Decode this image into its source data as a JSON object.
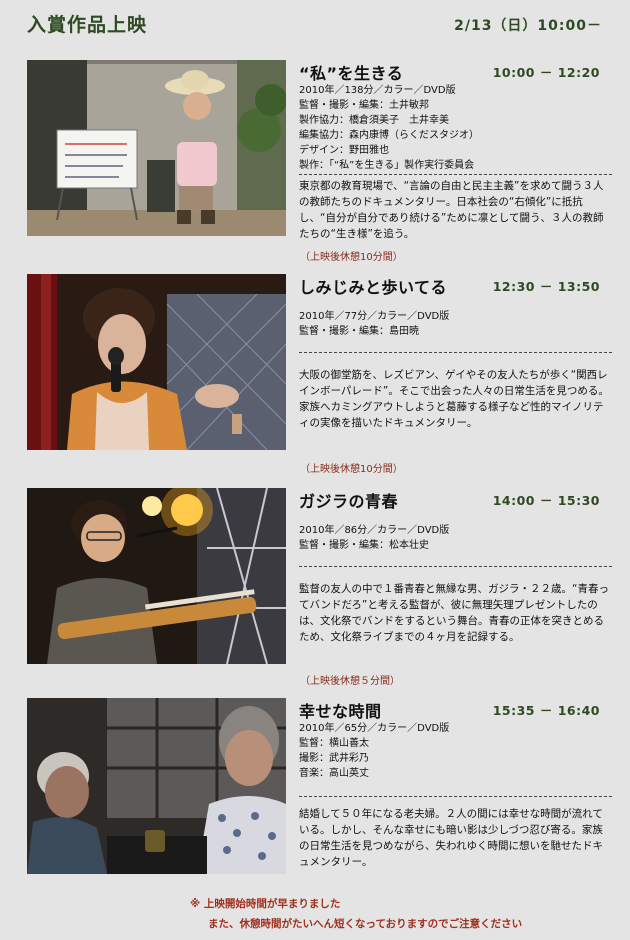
{
  "header": {
    "title": "入賞作品上映",
    "date": "2/13（日）10:00－"
  },
  "films": [
    {
      "title": "“私”を生きる",
      "time": "10:00 － 12:20",
      "credits": [
        "2010年／138分／カラー／DVD版",
        "監督・撮影・編集：土井敏邦",
        "製作協力：橋倉須美子　土井幸美",
        "編集協力：森内康博（らくだスタジオ）",
        "デザイン：野田雅也",
        "製作：「“私”を生きる」製作実行委員会"
      ],
      "description": "東京都の教育現場で、“言論の自由と民主主義”を求めて闘う３人の教師たちのドキュメンタリー。日本社会の“右傾化”に抵抗し、“自分が自分であり続ける”ために凛として闘う、３人の教師たちの“生き様”を追う。",
      "intermission": "（上映後休憩10分間）"
    },
    {
      "title": "しみじみと歩いてる",
      "time": "12:30 － 13:50",
      "credits": [
        "2010年／77分／カラー／DVD版",
        "監督・撮影・編集：島田暁"
      ],
      "description": "大阪の御堂筋を、レズビアン、ゲイやその友人たちが歩く“関西レインボーパレード”。そこで出会った人々の日常生活を見つめる。家族へカミングアウトしようと葛藤する様子など性的マイノリティの実像を描いたドキュメンタリー。",
      "intermission": "（上映後休憩10分間）"
    },
    {
      "title": "ガジラの青春",
      "time": "14:00 － 15:30",
      "credits": [
        "2010年／86分／カラー／DVD版",
        "監督・撮影・編集：松本壮史"
      ],
      "description": "監督の友人の中で１番青春と無縁な男、ガジラ・２２歳。“青春ってバンドだろ”と考える監督が、彼に無理矢理プレゼントしたのは、文化祭でバンドをするという舞台。青春の正体を突きとめるため、文化祭ライブまでの４ヶ月を記録する。",
      "intermission": "（上映後休憩５分間）"
    },
    {
      "title": "幸せな時間",
      "time": "15:35 － 16:40",
      "credits": [
        "2010年／65分／カラー／DVD版",
        "監督：横山善太",
        "撮影：武井彩乃",
        "音楽：高山英丈"
      ],
      "description": "結婚して５０年になる老夫婦。２人の間には幸せな時間が流れている。しかし、そんな幸せにも暗い影は少しづつ忍び寄る。家族の日常生活を見つめながら、失われゆく時間に想いを馳せたドキュメンタリー。",
      "intermission": ""
    }
  ],
  "still_sign_text": "私はこうして生きてる",
  "notice": {
    "line1": "※ 上映開始時間が早まりました",
    "line2": "また、休憩時間がたいへん短くなっておりますのでご注意ください"
  },
  "colors": {
    "accent": "#2e4a23",
    "warning": "#a0301e",
    "background": "#e4e4e4"
  }
}
